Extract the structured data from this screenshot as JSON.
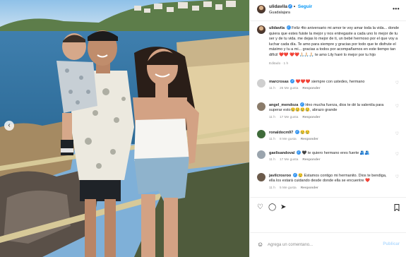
{
  "post": {
    "username": "ulidavila",
    "follow_label": "Seguir",
    "separator": "•",
    "location": "Guadalajara",
    "verified_mark": "✓",
    "more_icon": "more-horizontal-icon"
  },
  "caption": {
    "username": "ulidavila",
    "text": "Feliz 4to aniversario mi amor te voy amar toda la vida... donde quiera que estes fuiste la mejor y nos entregaste a cada uno lo mejor de tu ser y de tu vida. me dejas lo mejor de ti, un bebé hermoso por el que voy a luchar cada día. Te amo para siempre y gracias por todo que te disfrute el máximo y tu a mi... gracias a todos por acompañarnos en este tiempo tan difícil ❤️❤️ ❤️❤️🙏🏻🙏🏻🙏🏻 te amo Lily haré lo mejor por tu hijo",
    "meta": "Editado · 1 h"
  },
  "comments": [
    {
      "username": "marcrosas",
      "verified": true,
      "text": "❤️❤️❤️ siempre con ustedes, hermano",
      "time": "11 h",
      "likes": "26 Me gusta",
      "reply": "Responder",
      "avatar_color": "#cfcfcf"
    },
    {
      "username": "angel_mendoza",
      "verified": true,
      "text": "Hno mucha fuerza, dios te dé la valentía para superar esto😢😢😢😢, abrazo grande",
      "time": "11 h",
      "likes": "17 Me gusta",
      "reply": "Responder",
      "avatar_color": "#8a7b6a"
    },
    {
      "username": "ronaldocm97",
      "verified": true,
      "text": "😢😢",
      "time": "11 h",
      "likes": "8 Me gusta",
      "reply": "Responder",
      "avatar_color": "#3f6b3a"
    },
    {
      "username": "gaelisandoval",
      "verified": true,
      "text": "🖤 te quiero hermano eres fuerte 🫂🫂",
      "time": "11 h",
      "likes": "17 Me gusta",
      "reply": "Responder",
      "avatar_color": "#9aa4ad"
    },
    {
      "username": "javilcrosroo",
      "verified": true,
      "text": "😢 Estamos contigo mi hermanito. Dios te bendiga, ella los estará cuidando desde donde ella se encuentre ❤️",
      "time": "11 h",
      "likes": "5 Me gusta",
      "reply": "Responder",
      "avatar_color": "#6b5a4a"
    }
  ],
  "actions": {
    "like_icon": "heart-icon",
    "comment_icon": "comment-icon",
    "share_icon": "send-icon",
    "save_icon": "bookmark-icon"
  },
  "add_comment": {
    "emoji_icon": "emoji-icon",
    "placeholder": "Agrega un comentario...",
    "post_label": "Publicar"
  },
  "photo": {
    "prev_icon": "chevron-left-icon"
  },
  "colors": {
    "link_blue": "#0095f6",
    "verified_blue": "#3897f0",
    "muted": "#8e8e8e"
  }
}
